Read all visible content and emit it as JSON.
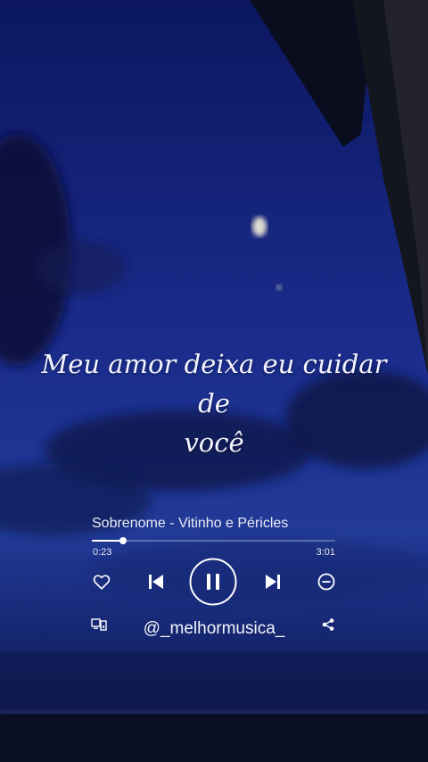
{
  "lyric": {
    "line1": "Meu amor deixa eu cuidar de",
    "line2": "você"
  },
  "player": {
    "track_title": "Sobrenome - Vitinho e Péricles",
    "elapsed": "0:23",
    "duration": "3:01",
    "progress_fraction": 0.127,
    "state": "playing"
  },
  "footer": {
    "handle": "@_melhormusica_"
  },
  "icons": {
    "like": "heart-icon",
    "previous": "skip-previous-icon",
    "pause": "pause-icon",
    "next": "skip-next-icon",
    "hide": "minus-circle-icon",
    "devices": "connect-device-icon",
    "share": "share-icon"
  },
  "colors": {
    "sky_top": "#0e1a6b",
    "sky_bottom": "#1a2d8a",
    "foreground": "#ffffff"
  }
}
